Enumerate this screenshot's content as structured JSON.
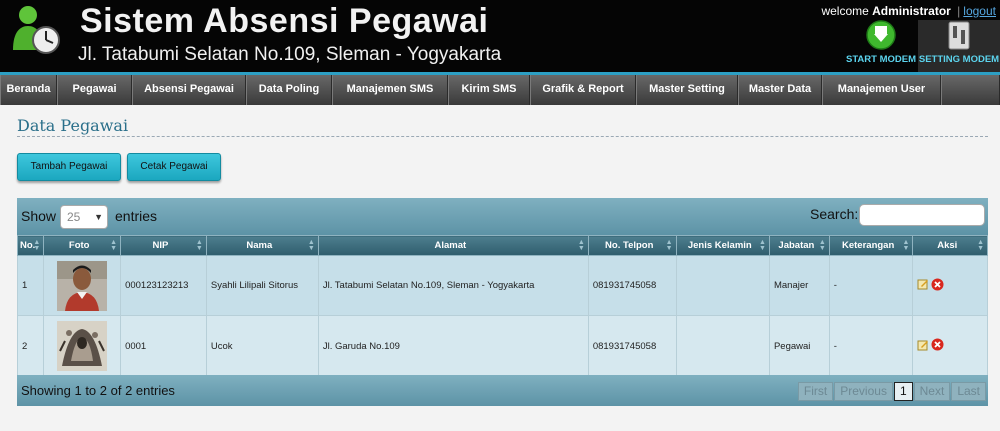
{
  "header": {
    "title": "Sistem Absensi Pegawai",
    "address": "Jl. Tatabumi Selatan No.109, Sleman - Yogyakarta",
    "welcome_prefix": "welcome",
    "user": "Administrator",
    "separator": "|",
    "logout": "logout",
    "start_modem": "START MODEM",
    "setting_modem": "SETTING MODEM"
  },
  "nav": [
    {
      "label": "Beranda",
      "width": 57
    },
    {
      "label": "Pegawai",
      "width": 75
    },
    {
      "label": "Absensi Pegawai",
      "width": 114
    },
    {
      "label": "Data Poling",
      "width": 86
    },
    {
      "label": "Manajemen SMS",
      "width": 116
    },
    {
      "label": "Kirim SMS",
      "width": 82
    },
    {
      "label": "Grafik & Report",
      "width": 106
    },
    {
      "label": "Master Setting",
      "width": 102
    },
    {
      "label": "Master Data",
      "width": 84
    },
    {
      "label": "Manajemen User",
      "width": 119
    },
    {
      "label": "",
      "width": 59
    }
  ],
  "page_title": "Data Pegawai",
  "buttons": {
    "add": "Tambah Pegawai",
    "print": "Cetak Pegawai"
  },
  "table_controls": {
    "show": "Show",
    "page_size": "25",
    "entries": "entries",
    "search": "Search:",
    "search_value": ""
  },
  "columns": [
    "No.",
    "Foto",
    "NIP",
    "Nama",
    "Alamat",
    "No. Telpon",
    "Jenis Kelamin",
    "Jabatan",
    "Keterangan",
    "Aksi"
  ],
  "rows": [
    {
      "no": "1",
      "nip": "000123123213",
      "nama": "Syahli Lilipali Sitorus",
      "alamat": "Jl. Tatabumi Selatan No.109, Sleman - Yogyakarta",
      "telpon": "081931745058",
      "jenis_kelamin": "",
      "jabatan": "Manajer",
      "keterangan": "-"
    },
    {
      "no": "2",
      "nip": "0001",
      "nama": "Ucok",
      "alamat": "Jl. Garuda No.109",
      "telpon": "081931745058",
      "jenis_kelamin": "",
      "jabatan": "Pegawai",
      "keterangan": "-"
    }
  ],
  "footer": {
    "info": "Showing 1 to 2 of 2 entries",
    "first": "First",
    "previous": "Previous",
    "current_page": "1",
    "next": "Next",
    "last": "Last"
  },
  "colors": {
    "accent": "#2c9fc4",
    "button": "#1ba7bf",
    "table_bar": "#5d93a6"
  }
}
